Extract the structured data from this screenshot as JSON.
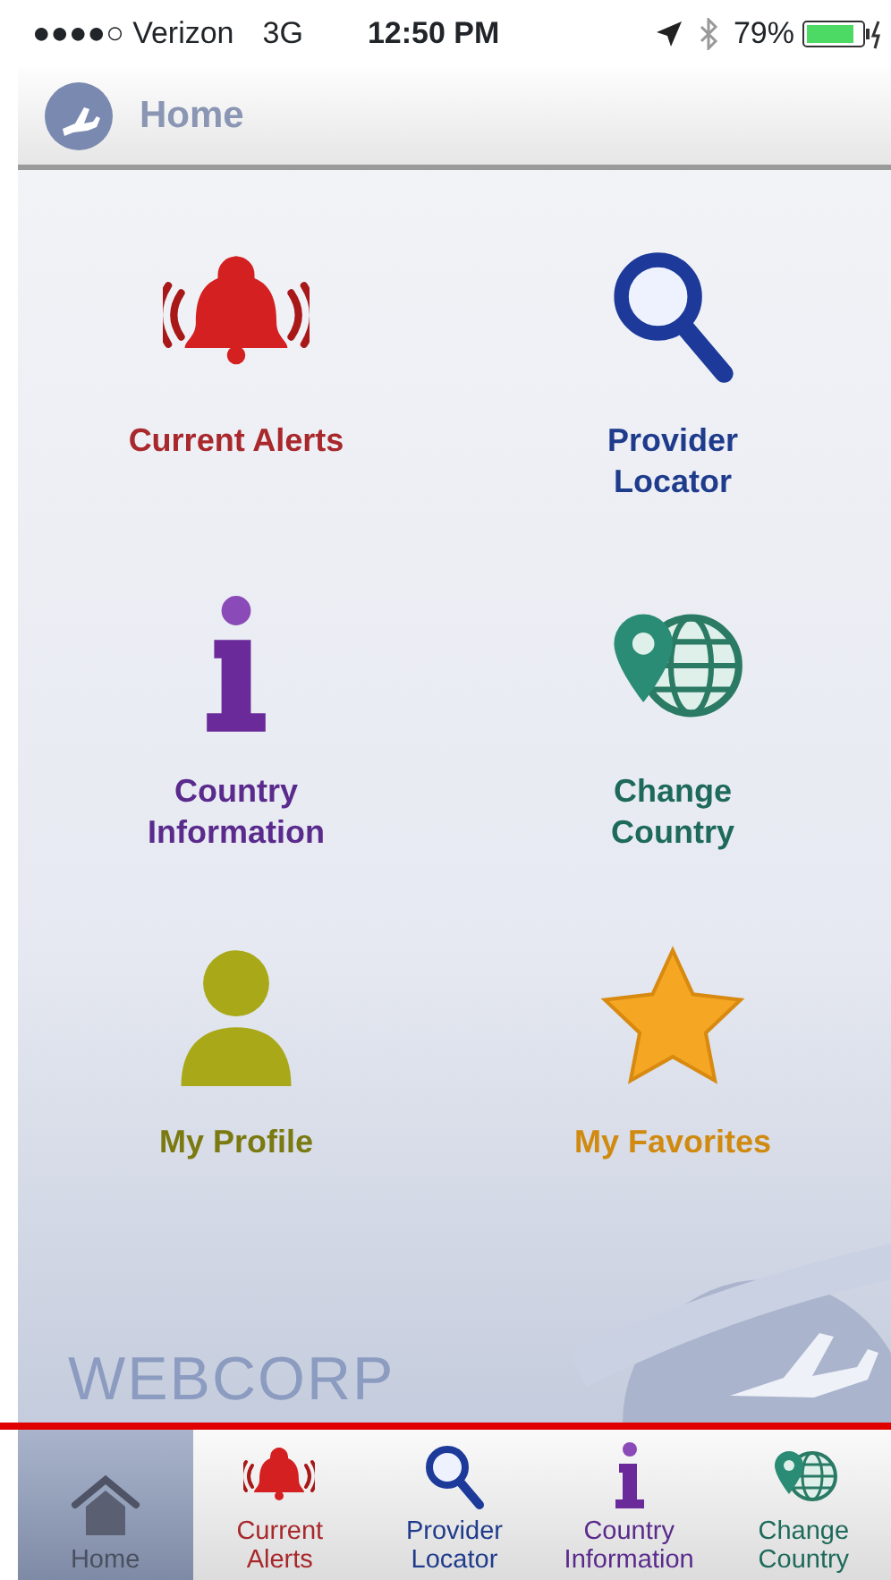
{
  "status_bar": {
    "carrier": "●●●●○ Verizon",
    "network": "3G",
    "time": "12:50 PM",
    "battery": "79%"
  },
  "header": {
    "title": "Home"
  },
  "tiles": [
    {
      "kind": "bell",
      "label": "Current Alerts",
      "color": "#a8282c"
    },
    {
      "kind": "magnifier",
      "label": "Provider Locator",
      "color": "#1f3b8c"
    },
    {
      "kind": "info",
      "label": "Country Information",
      "color": "#5a2a8c"
    },
    {
      "kind": "globe",
      "label": "Change Country",
      "color": "#1e6a5a"
    },
    {
      "kind": "person",
      "label": "My Profile",
      "color": "#7a7a10"
    },
    {
      "kind": "star",
      "label": "My Favorites",
      "color": "#d08a10"
    }
  ],
  "brand": "WEBCORP",
  "tab_bar": [
    {
      "kind": "house",
      "label": "Home",
      "selected": true,
      "color": "#4a5060"
    },
    {
      "kind": "bell",
      "label": "Current Alerts",
      "selected": false,
      "color": "#a8282c"
    },
    {
      "kind": "magnifier",
      "label": "Provider Locator",
      "selected": false,
      "color": "#1f3b8c"
    },
    {
      "kind": "info",
      "label": "Country Information",
      "selected": false,
      "color": "#5a2a8c"
    },
    {
      "kind": "globe",
      "label": "Change Country",
      "selected": false,
      "color": "#1e6a5a"
    }
  ]
}
